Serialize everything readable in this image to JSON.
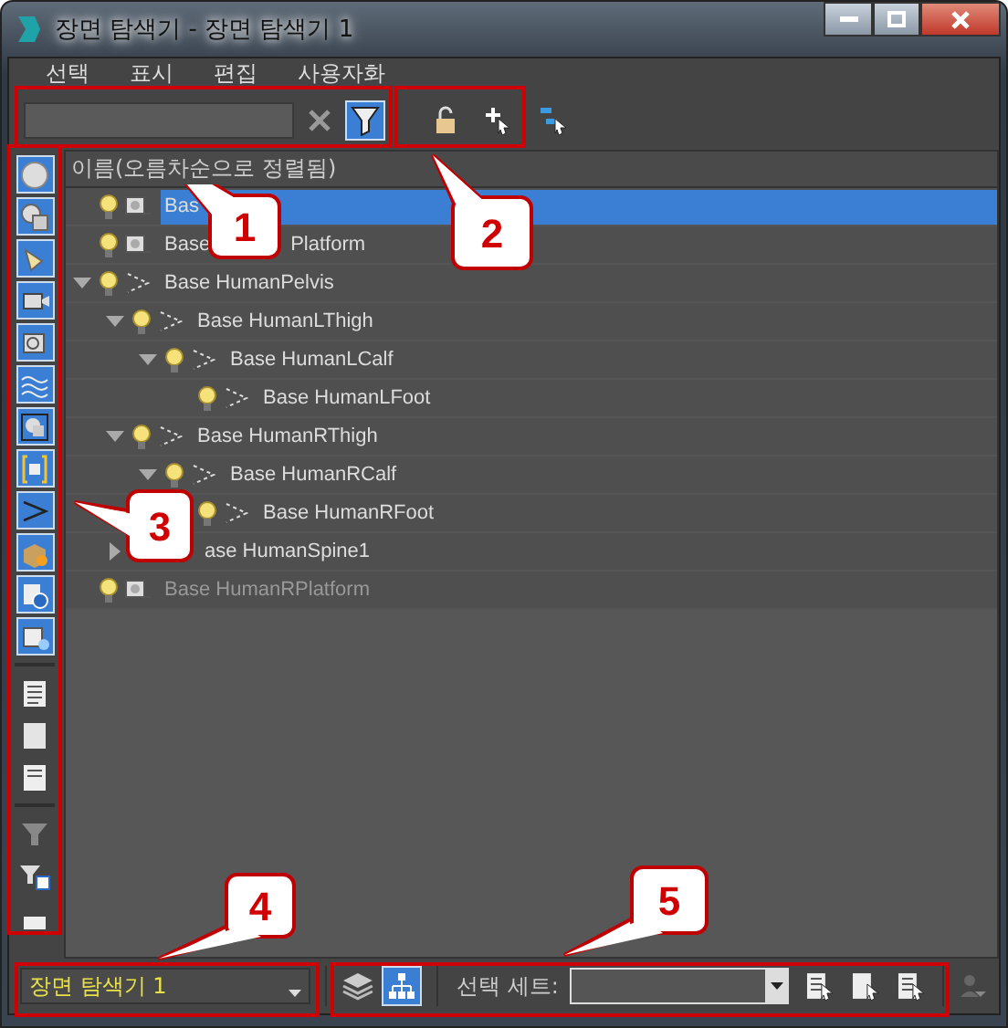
{
  "window": {
    "title": "장면 탐색기 - 장면 탐색기 1"
  },
  "menu": [
    "선택",
    "표시",
    "편집",
    "사용자화"
  ],
  "search": {
    "filter_on": true
  },
  "left_toolbar": [
    {
      "on": true
    },
    {
      "on": true
    },
    {
      "on": true
    },
    {
      "on": true
    },
    {
      "on": true
    },
    {
      "on": true
    },
    {
      "on": true
    },
    {
      "on": true
    },
    {
      "on": true
    },
    {
      "on": true
    },
    {
      "on": true
    },
    {
      "on": true
    },
    {
      "on": false
    },
    {
      "on": false
    },
    {
      "on": false
    },
    {
      "on": false
    },
    {
      "on": false
    },
    {
      "on": false
    }
  ],
  "tree": {
    "header": "이름(오름차순으로 정렬됨)",
    "items": [
      {
        "kind": "geometry",
        "name": "Bas",
        "selected": true
      },
      {
        "kind": "geometry",
        "name": "Base",
        "name_tail": "Platform",
        "selected": false
      },
      {
        "kind": "bone",
        "name": "Base HumanPelvis",
        "selected": false,
        "expanded": true,
        "children": [
          {
            "kind": "bone",
            "name": "Base HumanLThigh",
            "selected": false,
            "expanded": true,
            "children": [
              {
                "kind": "bone",
                "name": "Base HumanLCalf",
                "selected": false,
                "expanded": true,
                "children": [
                  {
                    "kind": "bone",
                    "name": "Base HumanLFoot",
                    "selected": false
                  }
                ]
              }
            ]
          },
          {
            "kind": "bone",
            "name": "Base HumanRThigh",
            "selected": false,
            "expanded": true,
            "children": [
              {
                "kind": "bone",
                "name": "Base HumanRCalf",
                "selected": false,
                "expanded": true,
                "children": [
                  {
                    "kind": "bone",
                    "name": "Base HumanRFoot",
                    "selected": false
                  }
                ]
              }
            ]
          },
          {
            "name": "ase HumanSpine1",
            "selected": false,
            "expanded": false,
            "icons_visible": false
          }
        ]
      },
      {
        "kind": "geometry",
        "name": "Base HumanRPlatform",
        "selected": false
      }
    ]
  },
  "bottom": {
    "explorer": "장면 탐색기 1",
    "hierarchy_on": true,
    "selection_set_label": "선택 세트:"
  },
  "callouts": [
    "1",
    "2",
    "3",
    "4",
    "5"
  ]
}
